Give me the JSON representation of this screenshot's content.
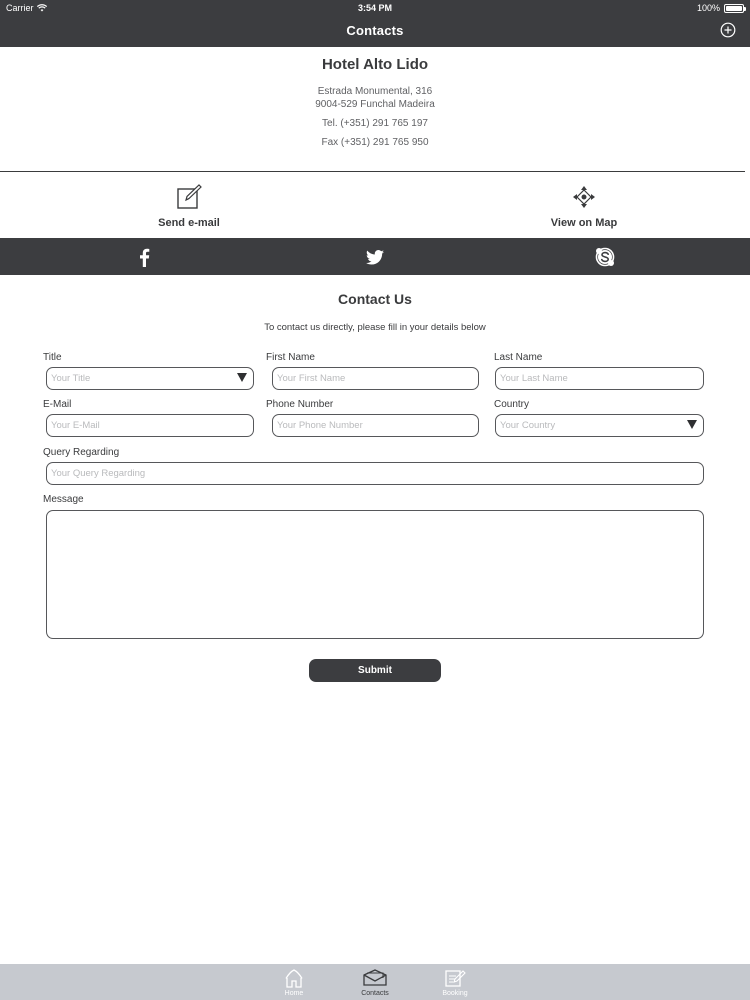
{
  "status_bar": {
    "carrier": "Carrier",
    "time": "3:54 PM",
    "battery": "100%",
    "battery_level": 1.0
  },
  "nav": {
    "title": "Contacts",
    "add_icon": "plus-circle-icon"
  },
  "hotel": {
    "name": "Hotel Alto Lido",
    "address_line1": "Estrada Monumental, 316",
    "address_line2": "9004-529 Funchal Madeira",
    "tel": "Tel. (+351) 291 765 197",
    "fax": "Fax (+351) 291 765 950"
  },
  "actions": {
    "email": {
      "label": "Send e-mail",
      "icon": "edit-icon"
    },
    "map": {
      "label": "View on Map",
      "icon": "map-pin-icon"
    }
  },
  "social": [
    "facebook-icon",
    "twitter-icon",
    "skype-icon"
  ],
  "contact": {
    "title": "Contact Us",
    "subtitle": "To contact us directly, please fill in your details below"
  },
  "form": {
    "title": {
      "label": "Title",
      "placeholder": "Your Title"
    },
    "first_name": {
      "label": "First Name",
      "placeholder": "Your First Name"
    },
    "last_name": {
      "label": "Last Name",
      "placeholder": "Your Last Name"
    },
    "email": {
      "label": "E-Mail",
      "placeholder": "Your E-Mail"
    },
    "phone": {
      "label": "Phone Number",
      "placeholder": "Your Phone Number"
    },
    "country": {
      "label": "Country",
      "placeholder": "Your Country"
    },
    "query": {
      "label": "Query Regarding",
      "placeholder": "Your Query Regarding"
    },
    "message": {
      "label": "Message",
      "placeholder": ""
    },
    "submit": "Submit"
  },
  "tabbar": {
    "colors": {
      "background": "#c6c9cf",
      "active": "#3a3b3d",
      "inactive": "#ffffff"
    },
    "items": [
      {
        "label": "Home",
        "icon": "home-icon",
        "active": false
      },
      {
        "label": "Contacts",
        "icon": "envelope-icon",
        "active": true
      },
      {
        "label": "Booking",
        "icon": "booking-icon",
        "active": false
      }
    ]
  },
  "colors": {
    "header": "#3c3d40",
    "text": "#3a3b3d",
    "placeholder": "#b9babc"
  }
}
